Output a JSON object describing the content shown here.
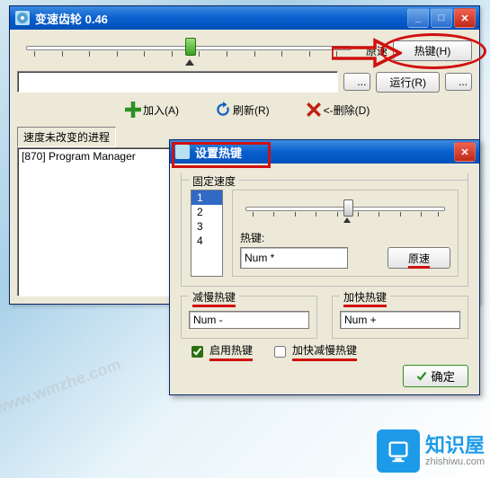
{
  "main": {
    "title": "变速齿轮 0.46",
    "orig_speed_label": "原速",
    "hotkey_button": "热键(H)",
    "run_button": "运行(R)",
    "dots": "...",
    "toolbar": {
      "add": "加入(A)",
      "refresh": "刷新(R)",
      "delete": "<-删除(D)"
    },
    "section_label": "速度未改变的进程",
    "process_item": "[870]  Program Manager"
  },
  "dialog": {
    "title": "设置热键",
    "fixed_speed_label": "固定速度",
    "list": [
      "1",
      "2",
      "3",
      "4"
    ],
    "hotkey_label": "热键:",
    "hotkey_value": "Num *",
    "orig_button": "原速",
    "slow_label": "减慢热键",
    "slow_value": "Num -",
    "fast_label": "加快热键",
    "fast_value": "Num +",
    "enable_label": "启用热键",
    "accel_label": "加快减慢热键",
    "ok_button": "确定"
  },
  "logo": {
    "cn": "知识屋",
    "en": "zhishiwu.com"
  },
  "watermarks": [
    "www.wmzhe.com",
    "www.wmzhe.com",
    "www.wmzhe.com",
    "www.wmzhe.com"
  ]
}
